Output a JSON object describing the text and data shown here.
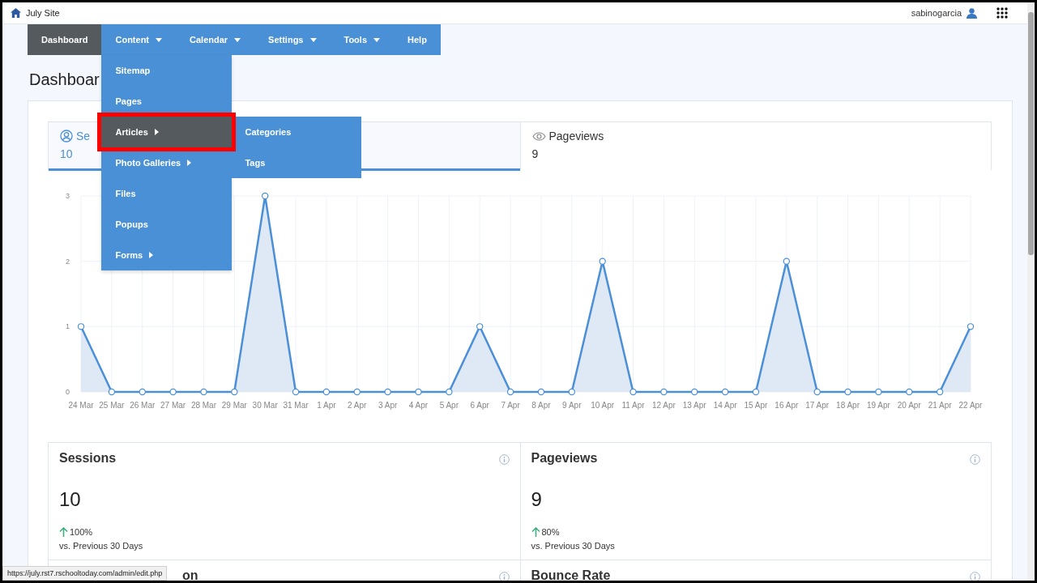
{
  "site": {
    "title": "July Site"
  },
  "user": {
    "name": "sabinogarcia"
  },
  "nav": [
    {
      "label": "Dashboard",
      "selected": true,
      "caret": false
    },
    {
      "label": "Content",
      "selected": false,
      "caret": true,
      "menu": [
        {
          "label": "Sitemap",
          "selected": false,
          "arrow": false,
          "highlighted": false
        },
        {
          "label": "Pages",
          "selected": false,
          "arrow": false,
          "highlighted": false
        },
        {
          "label": "Articles",
          "selected": true,
          "arrow": true,
          "highlighted": true,
          "children": [
            {
              "label": "Categories"
            },
            {
              "label": "Tags"
            }
          ]
        },
        {
          "label": "Photo Galleries",
          "selected": false,
          "arrow": true,
          "highlighted": false
        },
        {
          "label": "Files",
          "selected": false,
          "arrow": false,
          "highlighted": false
        },
        {
          "label": "Popups",
          "selected": false,
          "arrow": false,
          "highlighted": false
        },
        {
          "label": "Forms",
          "selected": false,
          "arrow": true,
          "highlighted": false
        }
      ]
    },
    {
      "label": "Calendar",
      "selected": false,
      "caret": true
    },
    {
      "label": "Settings",
      "selected": false,
      "caret": true
    },
    {
      "label": "Tools",
      "selected": false,
      "caret": true
    },
    {
      "label": "Help",
      "selected": false,
      "caret": false
    }
  ],
  "heading": "Dashboar",
  "tabs": [
    {
      "label": "Se",
      "value": "10",
      "selected": true
    },
    {
      "label": "Pageviews",
      "value": "9",
      "selected": false
    }
  ],
  "chart_data": {
    "type": "area",
    "grid": true,
    "categories": [
      "24 Mar",
      "25 Mar",
      "26 Mar",
      "27 Mar",
      "28 Mar",
      "29 Mar",
      "30 Mar",
      "31 Mar",
      "1 Apr",
      "2 Apr",
      "3 Apr",
      "4 Apr",
      "5 Apr",
      "6 Apr",
      "7 Apr",
      "8 Apr",
      "9 Apr",
      "10 Apr",
      "11 Apr",
      "12 Apr",
      "13 Apr",
      "14 Apr",
      "15 Apr",
      "16 Apr",
      "17 Apr",
      "18 Apr",
      "19 Apr",
      "20 Apr",
      "21 Apr",
      "22 Apr"
    ],
    "ylim": [
      0,
      3
    ],
    "yticks": [
      0,
      1,
      2,
      3
    ],
    "series": [
      {
        "color": "#4a8fd8",
        "values": [
          1,
          0,
          0,
          0,
          0,
          0,
          3,
          0,
          0,
          0,
          0,
          0,
          0,
          1,
          0,
          0,
          0,
          2,
          0,
          0,
          0,
          0,
          0,
          2,
          0,
          0,
          0,
          0,
          0,
          1
        ]
      }
    ]
  },
  "stats": [
    {
      "title": "Sessions",
      "value": "10",
      "change": "100%",
      "note": "vs. Previous 30 Days"
    },
    {
      "title": "Pageviews",
      "value": "9",
      "change": "80%",
      "note": "vs. Previous 30 Days"
    }
  ],
  "more_cards": [
    {
      "title": "on"
    },
    {
      "title": "Bounce Rate"
    }
  ],
  "status_bar": {
    "url": "https://july.rst7.rschooltoday.com/admin/edit.php"
  }
}
